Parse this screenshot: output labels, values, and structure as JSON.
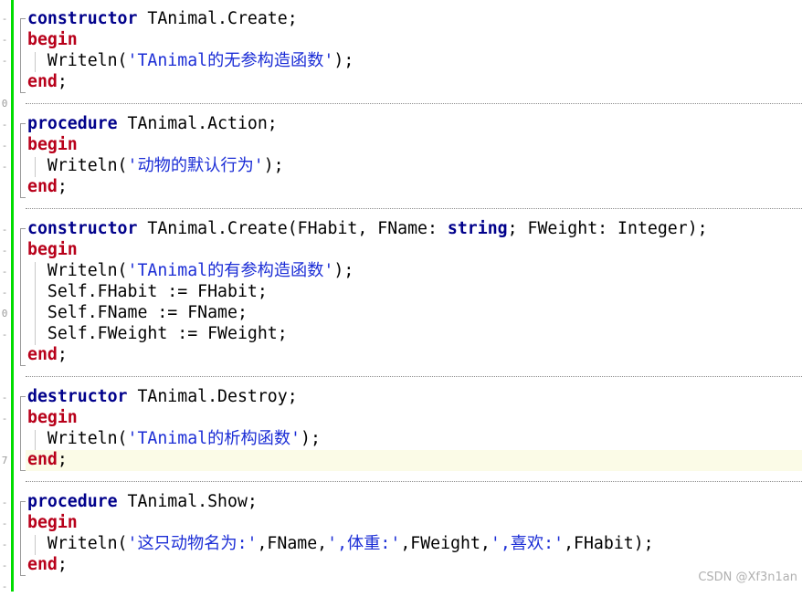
{
  "gutter_marks": [
    "-",
    "-",
    "-",
    "0",
    "-",
    "-",
    "-",
    "-",
    "-",
    "-",
    "-",
    "0",
    "-",
    "-",
    "-",
    "7",
    "-",
    "-",
    "-",
    "-",
    "-"
  ],
  "lines": {
    "l1": {
      "kw": "constructor",
      "rest": " TAnimal.Create;"
    },
    "l2": {
      "kw": "begin"
    },
    "l3": {
      "pre": "  Writeln(",
      "str": "'TAnimal的无参构造函数'",
      "post": ");"
    },
    "l4": {
      "kw": "end",
      "post": ";"
    },
    "l5": {
      "kw": "procedure",
      "rest": " TAnimal.Action;"
    },
    "l6": {
      "kw": "begin"
    },
    "l7": {
      "pre": "  Writeln(",
      "str": "'动物的默认行为'",
      "post": ");"
    },
    "l8": {
      "kw": "end",
      "post": ";"
    },
    "l9": {
      "kw": "constructor",
      "rest": " TAnimal.Create(FHabit, FName: ",
      "kw2": "string",
      "rest2": "; FWeight: Integer);"
    },
    "l10": {
      "kw": "begin"
    },
    "l11": {
      "pre": "  Writeln(",
      "str": "'TAnimal的有参构造函数'",
      "post": ");"
    },
    "l12": {
      "text": "  Self.FHabit := FHabit;"
    },
    "l13": {
      "text": "  Self.FName := FName;"
    },
    "l14": {
      "text": "  Self.FWeight := FWeight;"
    },
    "l15": {
      "kw": "end",
      "post": ";"
    },
    "l16": {
      "kw": "destructor",
      "rest": " TAnimal.Destroy;"
    },
    "l17": {
      "kw": "begin"
    },
    "l18": {
      "pre": "  Writeln(",
      "str": "'TAnimal的析构函数'",
      "post": ");"
    },
    "l19": {
      "kw": "end",
      "post": ";"
    },
    "l20": {
      "kw": "procedure",
      "rest": " TAnimal.Show;"
    },
    "l21": {
      "kw": "begin"
    },
    "l22": {
      "pre": "  Writeln(",
      "s1": "'这只动物名为:'",
      "m1": ",FName,",
      "s2": "',体重:'",
      "m2": ",FWeight,",
      "s3": "',喜欢:'",
      "m3": ",FHabit);"
    },
    "l23": {
      "kw": "end",
      "post": ";"
    }
  },
  "watermark": "CSDN @Xf3n1an",
  "colors": {
    "keyword": "#00008b",
    "begin_end": "#b8001a",
    "string": "#1c2ed6",
    "change_bar": "#00dd00",
    "current_line": "#fbfbe7"
  }
}
